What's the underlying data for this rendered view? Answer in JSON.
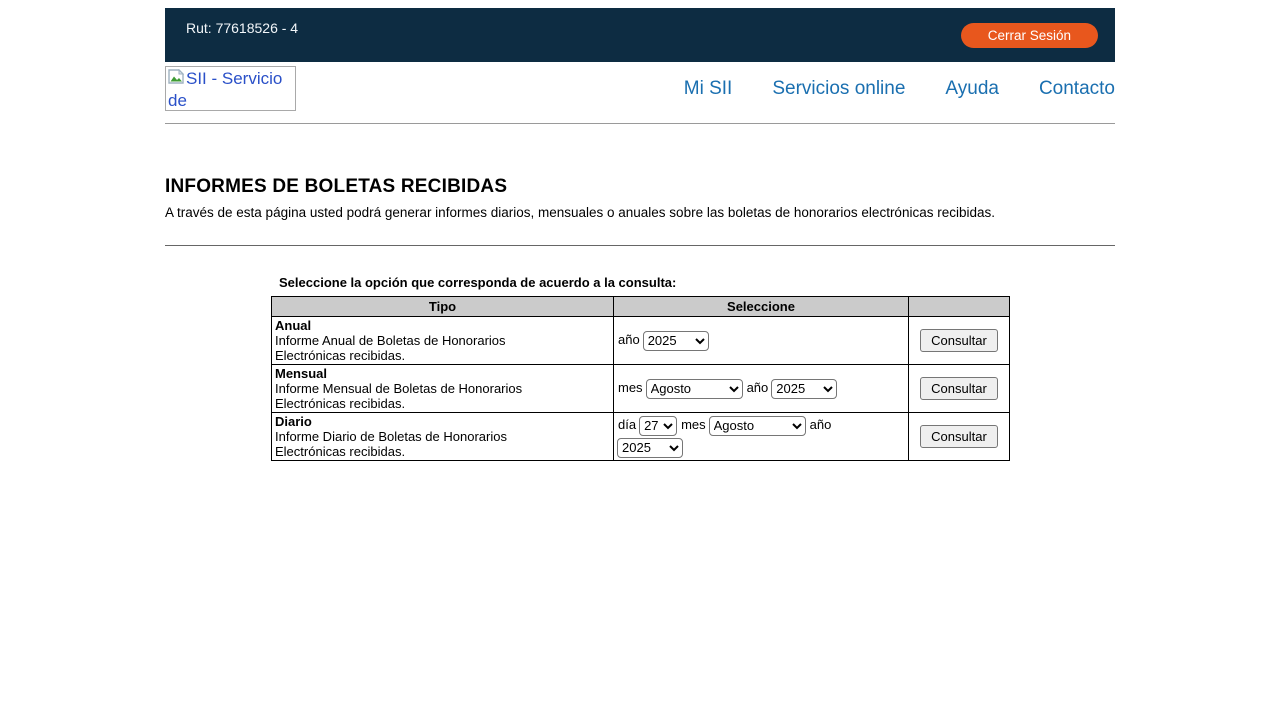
{
  "topbar": {
    "rut_label": "Rut: 77618526 - 4",
    "logout_label": "Cerrar Sesión"
  },
  "header": {
    "logo_alt": "SII - Servicio de",
    "logo_icon": "broken-image-icon",
    "nav": [
      {
        "label": "Mi SII"
      },
      {
        "label": "Servicios online"
      },
      {
        "label": "Ayuda"
      },
      {
        "label": "Contacto"
      }
    ]
  },
  "page": {
    "title": "INFORMES DE BOLETAS RECIBIDAS",
    "subtitle": "A través de esta página usted podrá generar informes diarios, mensuales o anuales sobre las boletas de honorarios electrónicas recibidas.",
    "section_label": "Seleccione la opción que corresponda de acuerdo a la consulta:"
  },
  "table": {
    "headers": [
      "Tipo",
      "Seleccione",
      ""
    ],
    "rows": [
      {
        "type": "Anual",
        "description": "Informe Anual de Boletas de Honorarios Electrónicas recibidas.",
        "fields": [
          {
            "label": "año",
            "value": "2025"
          }
        ],
        "button": "Consultar"
      },
      {
        "type": "Mensual",
        "description": "Informe Mensual de Boletas de Honorarios Electrónicas recibidas.",
        "fields": [
          {
            "label": "mes",
            "value": "Agosto"
          },
          {
            "label": "año",
            "value": "2025"
          }
        ],
        "button": "Consultar"
      },
      {
        "type": "Diario",
        "description": "Informe Diario de Boletas de Honorarios Electrónicas recibidas.",
        "fields": [
          {
            "label": "día",
            "value": "27"
          },
          {
            "label": "mes",
            "value": "Agosto"
          },
          {
            "label": "año",
            "value": "2025"
          }
        ],
        "button": "Consultar"
      }
    ]
  },
  "colors": {
    "topbar_bg": "#0d2c42",
    "logout_bg": "#e8571d",
    "nav_link": "#1a6fb0",
    "logo_alt_text": "#2a50c8",
    "table_header_bg": "#cbcbcb"
  }
}
